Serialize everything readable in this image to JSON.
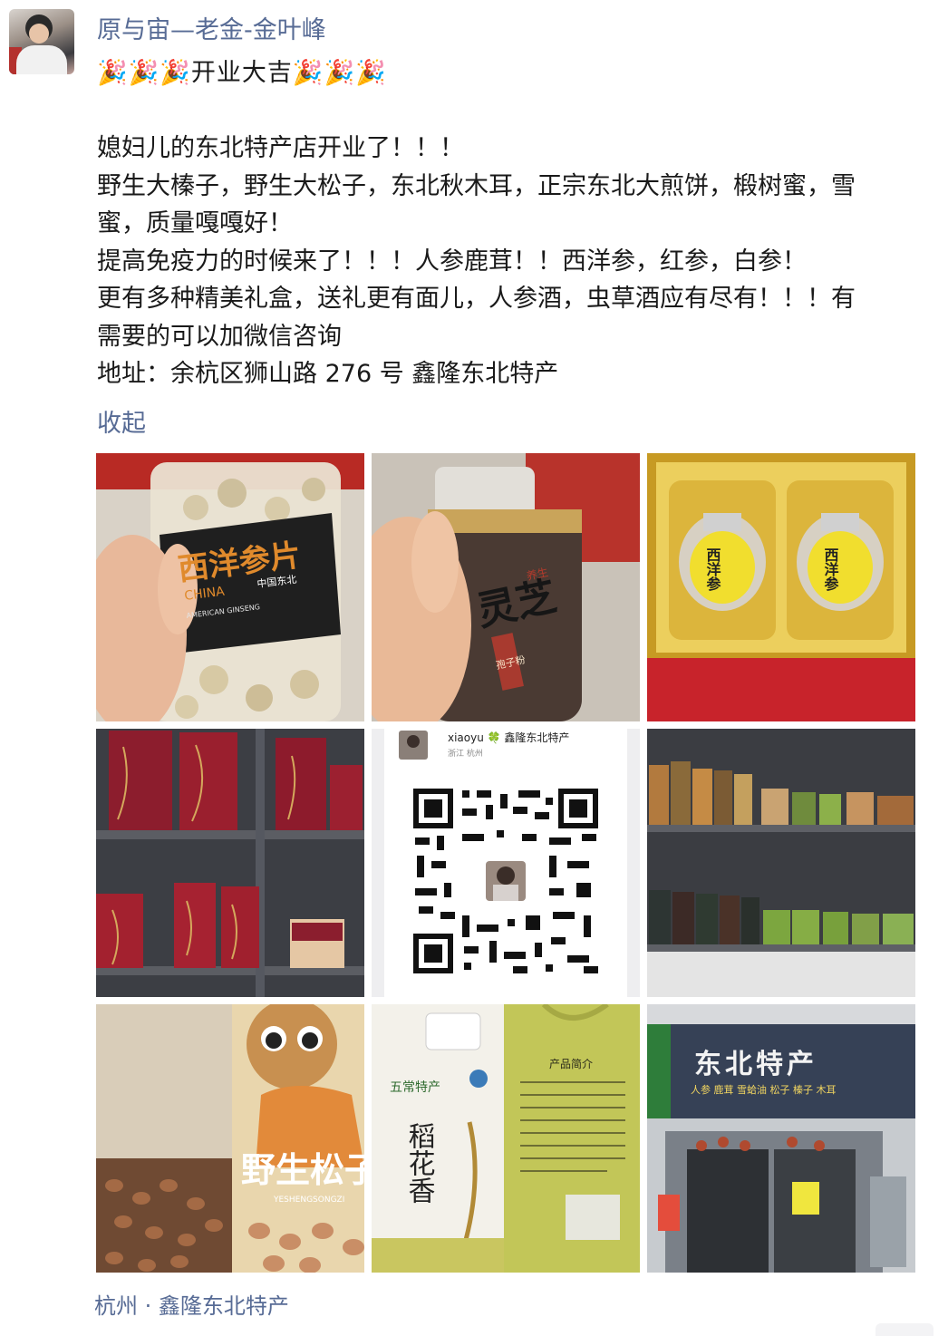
{
  "author": {
    "name": "原与宙—老金-金叶峰"
  },
  "post": {
    "lines": [
      "🎉🎉🎉开业大吉🎉🎉🎉",
      "",
      "媳妇儿的东北特产店开业了！！！",
      "野生大榛子，野生大松子，东北秋木耳，正宗东北大煎饼，椴树蜜，雪",
      "蜜，质量嘎嘎好！",
      "提高免疫力的时候来了！！！人参鹿茸！！西洋参，红参，白参！",
      "更有多种精美礼盒，送礼更有面儿，人参酒，虫草酒应有尽有！！！有",
      "需要的可以加微信咨询",
      "地址：余杭区狮山路 276 号 鑫隆东北特产"
    ],
    "collapse_label": "收起"
  },
  "photos": {
    "p1": {
      "label_main": "西洋参片",
      "label_en": "CHINA",
      "label_tag": "中国东北",
      "label_sub": "AMERICAN GINSENG"
    },
    "p2": {
      "label_main": "灵芝",
      "label_side": "养生",
      "label_tag": "孢子粉"
    },
    "p3": {
      "jar_label": "西洋参"
    },
    "p5": {
      "profile_name": "xiaoyu 🍀 鑫隆东北特产",
      "profile_region": "浙江 杭州"
    },
    "p7": {
      "bag_text": "野生松子",
      "bag_sub": "YESHENGSONGZI"
    },
    "p8": {
      "brand": "五常特产",
      "product": "稻花香",
      "side_title": "产品简介"
    },
    "p9": {
      "shop_sign": "东北特产",
      "shop_sub": "人参 鹿茸 雪蛤油 松子 榛子 木耳"
    }
  },
  "location": "杭州 · 鑫隆东北特产",
  "colors": {
    "link": "#576b95",
    "text": "#1a1a1a"
  }
}
